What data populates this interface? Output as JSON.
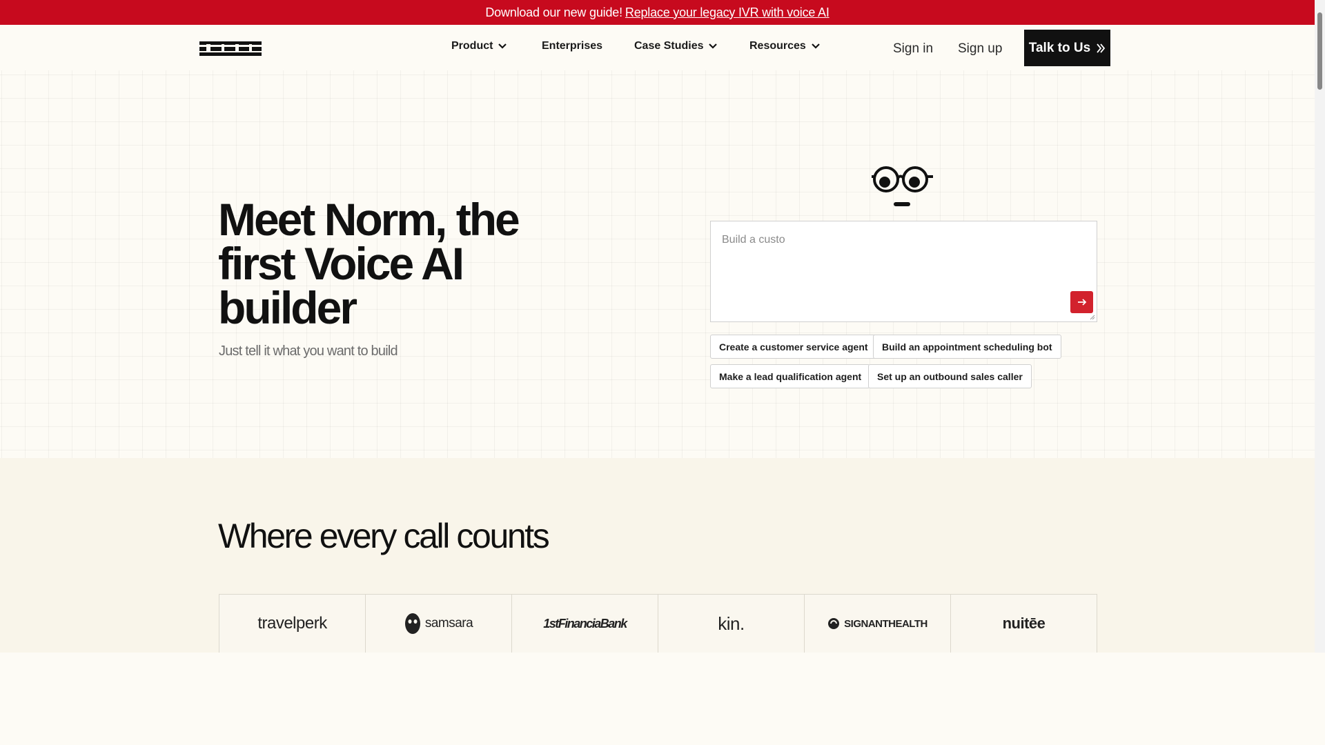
{
  "promo": {
    "text": "Download our new guide!",
    "link": "Replace your legacy IVR with voice AI"
  },
  "nav": {
    "logo_alt": "bland",
    "items": [
      {
        "label": "Product",
        "dropdown": true
      },
      {
        "label": "Enterprises",
        "dropdown": false
      },
      {
        "label": "Case Studies",
        "dropdown": true
      },
      {
        "label": "Resources",
        "dropdown": true
      }
    ],
    "sign_in": "Sign in",
    "sign_up": "Sign up",
    "cta": "Talk to Us"
  },
  "hero": {
    "headline": "Meet Norm, the first Voice AI builder",
    "subhead": "Just tell it what you want to build",
    "prompt_value": "Build a custo",
    "chips": [
      "Create a customer service agent",
      "Build an appointment scheduling bot",
      "Make a lead qualification agent",
      "Set up an outbound sales caller"
    ]
  },
  "customers": {
    "title": "Where every call counts",
    "logos": [
      "travelperk",
      "samsara",
      "1stFinanciaBank",
      "kin.",
      "SIGNANTHEALTH",
      "nuitēe"
    ]
  },
  "colors": {
    "promo_bg": "#c70a1e",
    "cta_bg": "#111111",
    "submit_bg": "#d2222d",
    "page_bg": "#fdfbf5"
  }
}
